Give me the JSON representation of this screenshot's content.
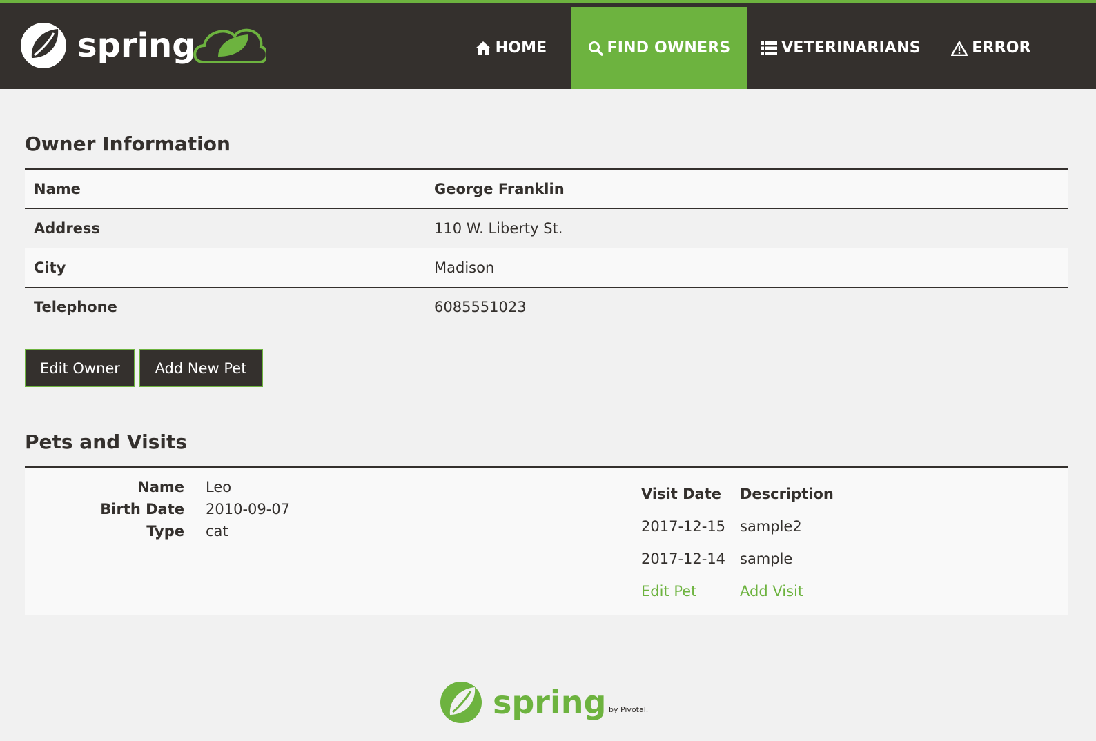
{
  "brand": {
    "logo_text": "spring",
    "tagline": "by Pivotal."
  },
  "nav": {
    "items": [
      {
        "label": "Home",
        "icon": "home-icon"
      },
      {
        "label": "Find Owners",
        "icon": "search-icon",
        "active": true
      },
      {
        "label": "Veterinarians",
        "icon": "list-icon"
      },
      {
        "label": "Error",
        "icon": "warning-icon"
      }
    ]
  },
  "owner": {
    "title": "Owner Information",
    "fields": [
      {
        "label": "Name",
        "value": "George Franklin"
      },
      {
        "label": "Address",
        "value": "110 W. Liberty St."
      },
      {
        "label": "City",
        "value": "Madison"
      },
      {
        "label": "Telephone",
        "value": "6085551023"
      }
    ],
    "edit_label": "Edit Owner",
    "add_pet_label": "Add New Pet"
  },
  "pets": {
    "title": "Pets and Visits",
    "pet": {
      "fields": [
        {
          "label": "Name",
          "value": "Leo"
        },
        {
          "label": "Birth Date",
          "value": "2010-09-07"
        },
        {
          "label": "Type",
          "value": "cat"
        }
      ]
    },
    "visits": {
      "headers": [
        "Visit Date",
        "Description"
      ],
      "rows": [
        {
          "date": "2017-12-15",
          "description": "sample2"
        },
        {
          "date": "2017-12-14",
          "description": "sample"
        }
      ],
      "edit_pet_label": "Edit Pet",
      "add_visit_label": "Add Visit"
    }
  },
  "colors": {
    "brand_green": "#6db33f",
    "dark": "#34302d",
    "background": "#f1f1f1"
  }
}
